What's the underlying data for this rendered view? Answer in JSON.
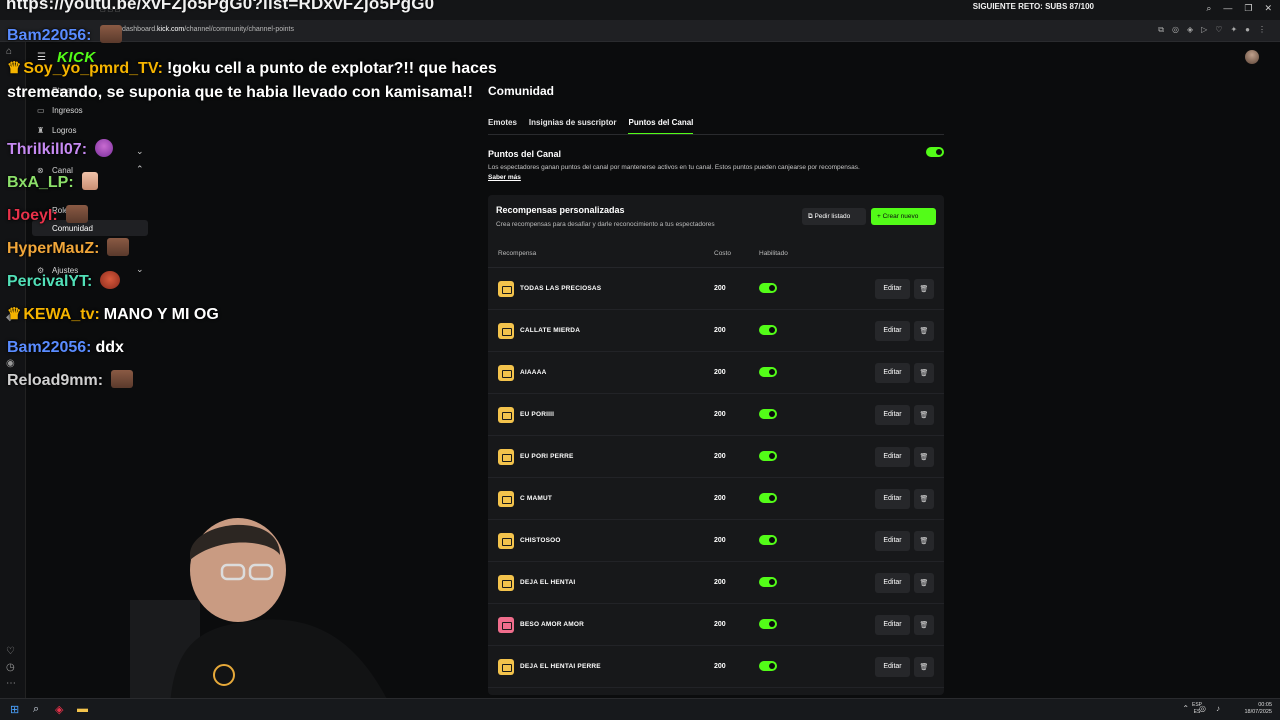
{
  "overlay": {
    "url": "https://youtu.be/xvFZjo5PgG0?list=RDxvFZjo5PgG0",
    "goal": "SIGUIENTE RETO: SUBS 87/100"
  },
  "browser": {
    "address_prefix": "dashboard.",
    "address_domain": "kick.com",
    "address_path": "/channel/community/channel-points"
  },
  "sidebar": {
    "logo": "KICK",
    "items": [
      {
        "label": "Stream"
      },
      {
        "label": "Ingresos"
      },
      {
        "label": "Logros"
      },
      {
        "label": "Canal"
      },
      {
        "label": "Roles"
      },
      {
        "label": "Comunidad"
      },
      {
        "label": "Ajustes"
      }
    ]
  },
  "chat": [
    {
      "user": "Bam22056:",
      "color": "#5a8cff",
      "text": ""
    },
    {
      "user": "Soy_yo_pmrd_TV:",
      "color": "#f5b400",
      "text": "!goku cell a punto de explotar?!! que haces stremeando, se suponia que te habia llevado con kamisama!!"
    },
    {
      "user": "Thrilkill07:",
      "color": "#c68af2",
      "text": ""
    },
    {
      "user": "BxA_LP:",
      "color": "#8ce06a",
      "text": ""
    },
    {
      "user": "IJoeyI:",
      "color": "#e8324a",
      "text": ""
    },
    {
      "user": "HyperMauZ:",
      "color": "#f0a63a",
      "text": ""
    },
    {
      "user": "PercivalYT:",
      "color": "#52e0b8",
      "text": ""
    },
    {
      "user": "KEWA_tv:",
      "color": "#f5b400",
      "text": "MANO Y MI OG"
    },
    {
      "user": "Bam22056:",
      "color": "#5a8cff",
      "text": "ddx"
    },
    {
      "user": "Reload9mm:",
      "color": "#d0d0d0",
      "text": ""
    }
  ],
  "page": {
    "title": "Comunidad",
    "tabs": [
      "Emotes",
      "Insignias de suscriptor",
      "Puntos del Canal"
    ],
    "channel_points": {
      "title": "Puntos del Canal",
      "description": "Los espectadores ganan puntos del canal por mantenerse activos en tu canal. Estos puntos pueden canjearse por recompensas.",
      "learn_more": "Saber más"
    },
    "rewards": {
      "title": "Recompensas personalizadas",
      "description": "Crea recompensas para desafiar y darle reconocimiento a tus espectadores",
      "request_button": "Pedir listado",
      "create_button": "Crear nuevo",
      "columns": [
        "Recompensa",
        "Costo",
        "Habilitado"
      ],
      "edit_label": "Editar",
      "rows": [
        {
          "name": "TODAS LAS PRECIOSAS",
          "cost": "200",
          "color": "#f3c34c"
        },
        {
          "name": "CALLATE MIERDA",
          "cost": "200",
          "color": "#f3c34c"
        },
        {
          "name": "AIAAAA",
          "cost": "200",
          "color": "#f3c34c"
        },
        {
          "name": "EU PORIIII",
          "cost": "200",
          "color": "#f3c34c"
        },
        {
          "name": "EU PORI PERRE",
          "cost": "200",
          "color": "#f3c34c"
        },
        {
          "name": "C MAMUT",
          "cost": "200",
          "color": "#f3c34c"
        },
        {
          "name": "CHISTOSOO",
          "cost": "200",
          "color": "#f3c34c"
        },
        {
          "name": "DEJA EL HENTAI",
          "cost": "200",
          "color": "#f3c34c"
        },
        {
          "name": "BESO AMOR AMOR",
          "cost": "200",
          "color": "#f06d8c"
        },
        {
          "name": "DEJA EL HENTAI PERRE",
          "cost": "200",
          "color": "#f3c34c"
        }
      ]
    }
  },
  "taskbar": {
    "lang_top": "ESP",
    "lang_bottom": "ES",
    "time": "00:05",
    "date": "18/07/2025"
  },
  "colors": {
    "accent": "#53fc18",
    "background": "#0b0c0d",
    "panel": "#17181a"
  }
}
